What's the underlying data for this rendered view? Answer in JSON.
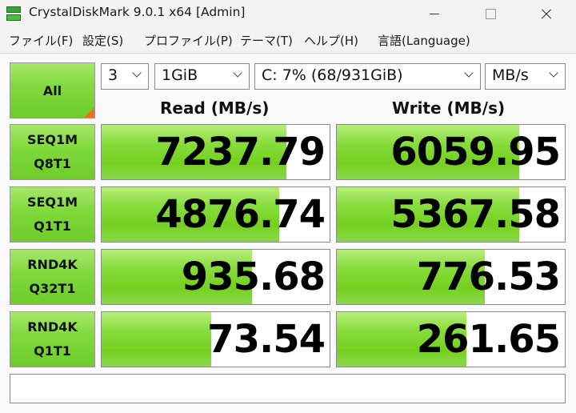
{
  "window": {
    "title": "CrystalDiskMark 9.0.1 x64 [Admin]"
  },
  "menu": [
    "ファイル(F)",
    "設定(S)",
    "プロファイル(P)",
    "テーマ(T)",
    "ヘルプ(H)",
    "言語(Language)"
  ],
  "controls": {
    "all_label": "All",
    "count": "3",
    "size": "1GiB",
    "drive": "C: 7% (68/931GiB)",
    "unit": "MB/s"
  },
  "headers": {
    "read": "Read (MB/s)",
    "write": "Write (MB/s)"
  },
  "tests": [
    {
      "line1": "SEQ1M",
      "line2": "Q8T1",
      "read": "7237.79",
      "write": "6059.95",
      "read_fill": 0.81,
      "write_fill": 0.8
    },
    {
      "line1": "SEQ1M",
      "line2": "Q1T1",
      "read": "4876.74",
      "write": "5367.58",
      "read_fill": 0.78,
      "write_fill": 0.8
    },
    {
      "line1": "RND4K",
      "line2": "Q32T1",
      "read": "935.68",
      "write": "776.53",
      "read_fill": 0.66,
      "write_fill": 0.65
    },
    {
      "line1": "RND4K",
      "line2": "Q1T1",
      "read": "73.54",
      "write": "261.65",
      "read_fill": 0.48,
      "write_fill": 0.57
    }
  ],
  "status": {
    "text": ""
  }
}
